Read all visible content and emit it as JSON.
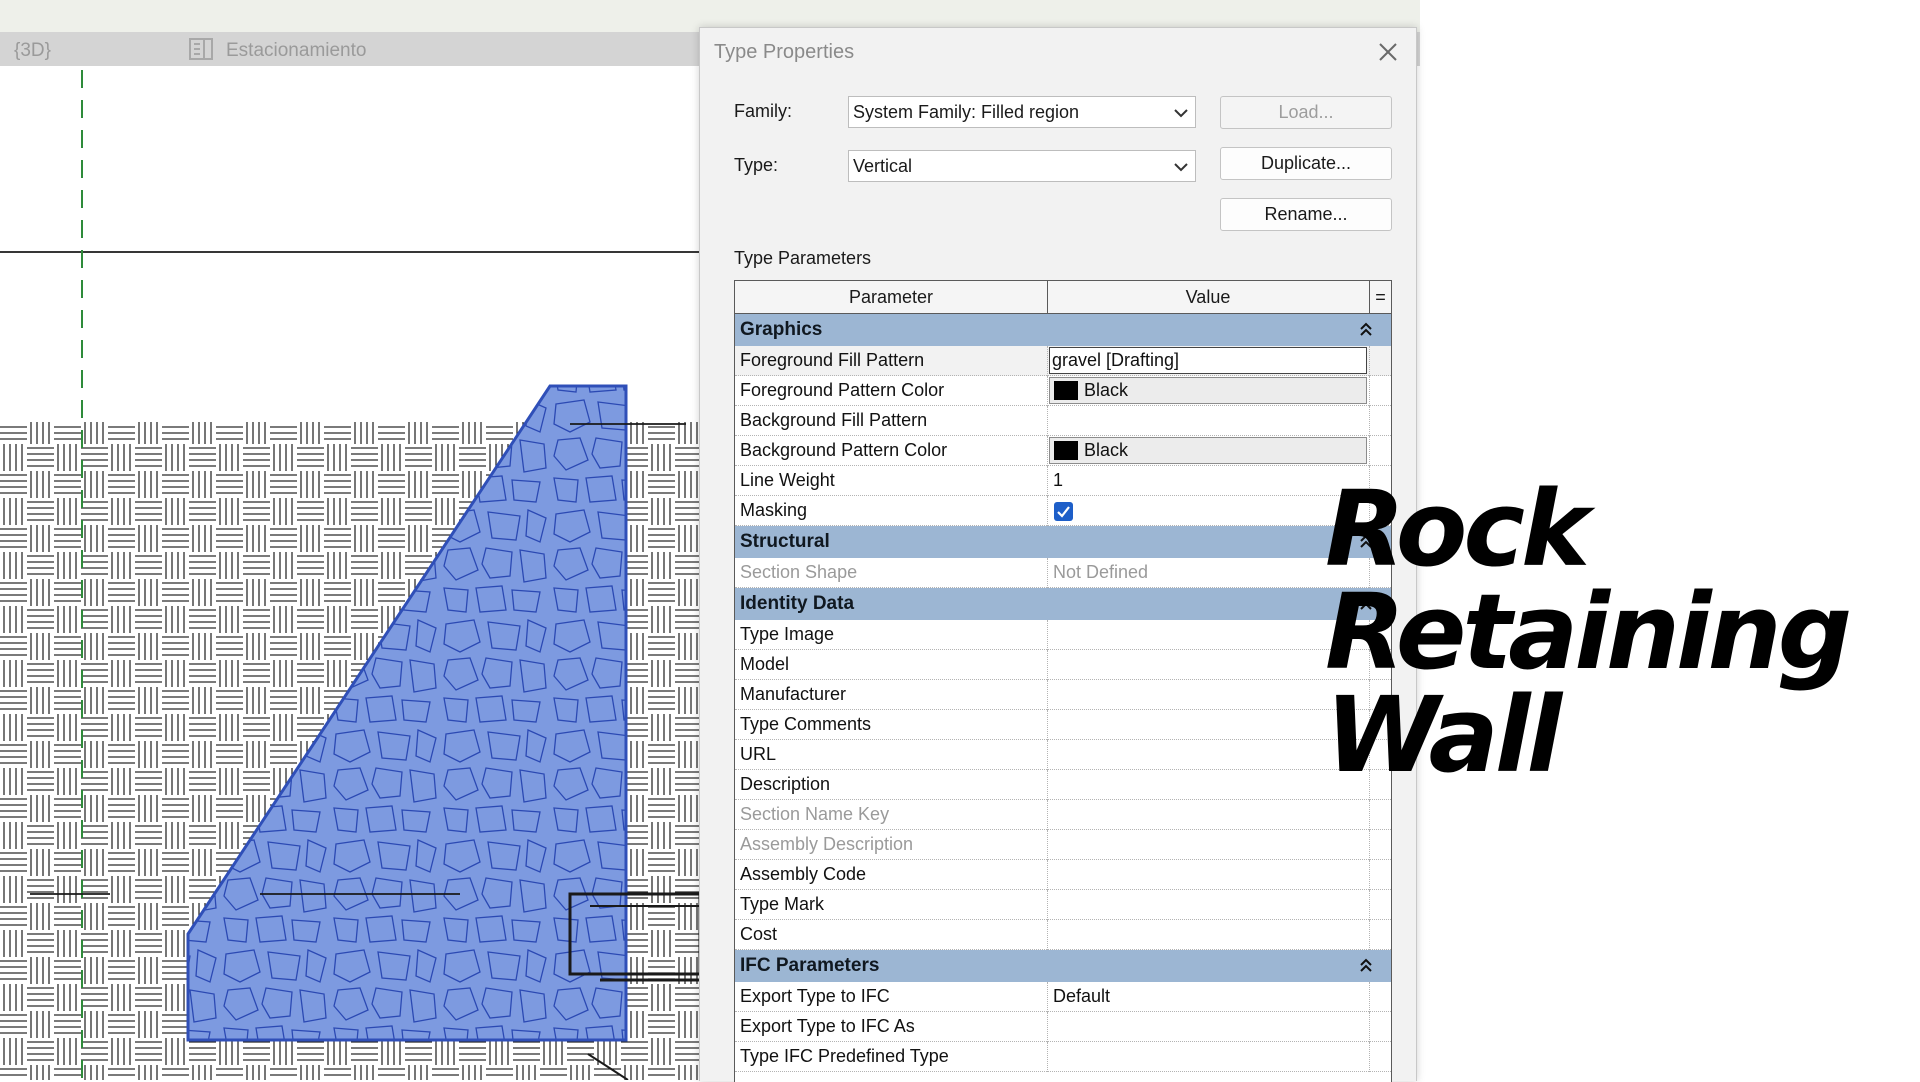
{
  "tabs": [
    {
      "label": "{3D}",
      "icon": "3d-view-icon"
    },
    {
      "label": "Estacionamiento",
      "icon": "sheet-view-icon"
    }
  ],
  "dialog": {
    "title": "Type Properties",
    "family_label": "Family:",
    "family_value": "System Family: Filled region",
    "type_label": "Type:",
    "type_value": "Vertical",
    "load_label": "Load...",
    "duplicate_label": "Duplicate...",
    "rename_label": "Rename...",
    "section_caption": "Type Parameters",
    "columns": {
      "parameter": "Parameter",
      "value": "Value",
      "eq": "="
    },
    "groups": {
      "graphics": {
        "label": "Graphics",
        "rows": [
          {
            "param": "Foreground Fill Pattern",
            "value": "gravel [Drafting]"
          },
          {
            "param": "Foreground Pattern Color",
            "value": "Black",
            "swatch": "#000000"
          },
          {
            "param": "Background Fill Pattern",
            "value": ""
          },
          {
            "param": "Background Pattern Color",
            "value": "Black",
            "swatch": "#000000"
          },
          {
            "param": "Line Weight",
            "value": "1"
          },
          {
            "param": "Masking",
            "value": "",
            "checked": true
          }
        ]
      },
      "structural": {
        "label": "Structural",
        "rows": [
          {
            "param": "Section Shape",
            "value": "Not Defined"
          }
        ]
      },
      "identity": {
        "label": "Identity Data",
        "rows": [
          {
            "param": "Type Image",
            "value": ""
          },
          {
            "param": "Model",
            "value": ""
          },
          {
            "param": "Manufacturer",
            "value": ""
          },
          {
            "param": "Type Comments",
            "value": ""
          },
          {
            "param": "URL",
            "value": ""
          },
          {
            "param": "Description",
            "value": ""
          },
          {
            "param": "Section Name Key",
            "value": ""
          },
          {
            "param": "Assembly Description",
            "value": ""
          },
          {
            "param": "Assembly Code",
            "value": ""
          },
          {
            "param": "Type Mark",
            "value": ""
          },
          {
            "param": "Cost",
            "value": ""
          }
        ]
      },
      "ifc": {
        "label": "IFC Parameters",
        "rows": [
          {
            "param": "Export Type to IFC",
            "value": "Default"
          },
          {
            "param": "Export Type to IFC As",
            "value": ""
          },
          {
            "param": "Type IFC Predefined Type",
            "value": ""
          }
        ]
      }
    }
  },
  "overlay_title": [
    "Rock",
    "Retaining",
    "Wall"
  ],
  "colors": {
    "region_fill": "#7d9ae0",
    "region_stroke": "#2f4fb8",
    "group_header": "#9cb6d3",
    "checkbox": "#1d5ec8",
    "grid_line": "#2e8b3a"
  }
}
